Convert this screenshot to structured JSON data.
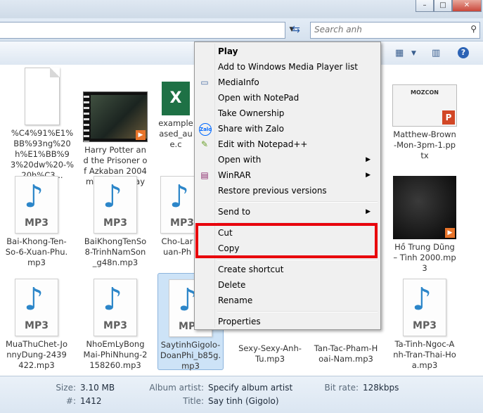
{
  "search": {
    "placeholder": "Search anh"
  },
  "window_controls": {
    "minimize": "–",
    "maximize": "□",
    "close": "✕"
  },
  "tiles": [
    {
      "label": "%C4%91%E1%BB%93ng%20h%E1%BB%93%20dw%20-%20h%C3...",
      "kind": "doc"
    },
    {
      "label": "Harry Potter and the Prisoner of Azkaban 2004 m720p BluRay x...",
      "kind": "video"
    },
    {
      "label": "example ased_au e.c",
      "kind": "excel"
    },
    {
      "label": "Matthew-Brown-Mon-3pm-1.pptx",
      "kind": "ppt",
      "thumb_title": "MOZCON"
    },
    {
      "label": "Bai-Khong-Ten-So-6-Xuan-Phu.mp3",
      "kind": "mp3"
    },
    {
      "label": "BaiKhongTenSo8-TrinhNamSon_g48n.mp3",
      "kind": "mp3"
    },
    {
      "label": "Cho-Lar uan-Ph",
      "kind": "mp3"
    },
    {
      "label": "Hồ Trung Dũng – Tình 2000.mp3",
      "kind": "album"
    },
    {
      "label": "MuaThuChet-JonnyDung-2439422.mp3",
      "kind": "mp3"
    },
    {
      "label": "NhoEmLyBongMai-PhiNhung-2158260.mp3",
      "kind": "mp3"
    },
    {
      "label": "SaytinhGigolo-DoanPhi_b85g.mp3",
      "kind": "mp3",
      "selected": true
    },
    {
      "label": "Sexy-Sexy-Anh-Tu.mp3",
      "kind": "none"
    },
    {
      "label": "Tan-Tac-Pham-Hoai-Nam.mp3",
      "kind": "none"
    },
    {
      "label": "Ta-Tinh-Ngoc-Anh-Tran-Thai-Hoa.mp3",
      "kind": "mp3"
    }
  ],
  "mp3_text": "MP3",
  "excel_letter": "X",
  "ppt_badge": "P",
  "context_menu": {
    "play": "Play",
    "add_wmp": "Add to Windows Media Player list",
    "mediainfo": "MediaInfo",
    "open_notepad": "Open with NotePad",
    "take_ownership": "Take Ownership",
    "share_zalo": "Share with Zalo",
    "zalo_icon_text": "Zalo",
    "edit_notepadpp": "Edit with Notepad++",
    "open_with": "Open with",
    "winrar": "WinRAR",
    "restore": "Restore previous versions",
    "send_to": "Send to",
    "cut": "Cut",
    "copy": "Copy",
    "create_shortcut": "Create shortcut",
    "delete": "Delete",
    "rename": "Rename",
    "properties": "Properties"
  },
  "details": {
    "size_key": "Size:",
    "size_val": "3.10 MB",
    "num_key": "#:",
    "num_val": "1412",
    "album_artist_key": "Album artist:",
    "album_artist_val": "Specify album artist",
    "title_key": "Title:",
    "title_val": "Say tinh  (Gigolo)",
    "bitrate_key": "Bit rate:",
    "bitrate_val": "128kbps"
  },
  "colors": {
    "highlight_box": "#e8000b",
    "mp3_note": "#2c86c9",
    "excel": "#1e7145",
    "ppt": "#d24726"
  }
}
